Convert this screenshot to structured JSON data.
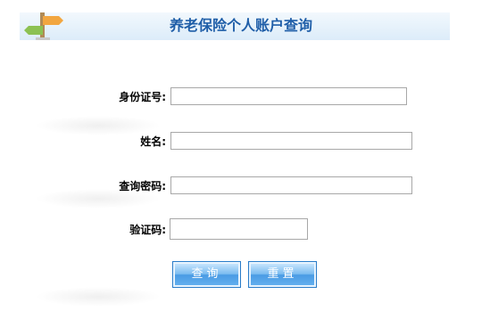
{
  "header": {
    "title": "养老保险个人账户查询",
    "icon": "signpost-icon"
  },
  "form": {
    "id_label": "身份证号:",
    "name_label": "姓名:",
    "password_label": "查询密码:",
    "captcha_label": "验证码:",
    "id_value": "",
    "name_value": "",
    "password_value": "",
    "captcha_value": ""
  },
  "buttons": {
    "query_label": "查询",
    "reset_label": "重置"
  },
  "colors": {
    "title": "#1f5ea8",
    "button": "#4a9be4"
  }
}
